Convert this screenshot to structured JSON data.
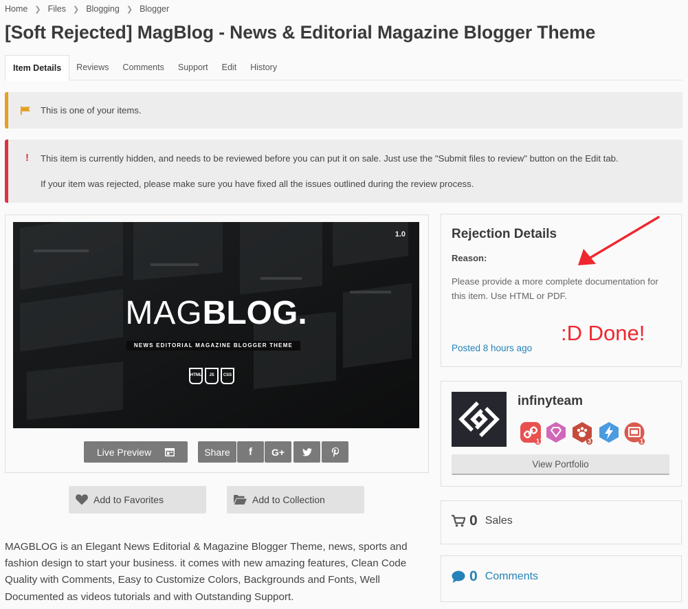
{
  "breadcrumb": [
    "Home",
    "Files",
    "Blogging",
    "Blogger"
  ],
  "title": "[Soft Rejected] MagBlog - News & Editorial Magazine Blogger Theme",
  "tabs": [
    "Item Details",
    "Reviews",
    "Comments",
    "Support",
    "Edit",
    "History"
  ],
  "notices": {
    "info": "This is one of your items.",
    "warning_line1": "This item is currently hidden, and needs to be reviewed before you can put it on sale. Just use the \"Submit files to review\" button on the Edit tab.",
    "warning_line2": "If your item was rejected, please make sure you have fixed all the issues outlined during the review process."
  },
  "preview": {
    "logo_light": "MAG",
    "logo_bold": "BLOG",
    "logo_dot": ".",
    "tagline": "NEWS EDITORIAL MAGAZINE BLOGGER THEME",
    "version": "1.0",
    "tech": [
      "HTML",
      "JS",
      "CSS"
    ]
  },
  "actions": {
    "live_preview": "Live Preview",
    "share": "Share",
    "social_icons": [
      "facebook-icon",
      "google-plus-icon",
      "twitter-icon",
      "pinterest-icon"
    ],
    "social_glyphs": [
      "f",
      "G+",
      "t",
      "p"
    ],
    "add_favorites": "Add to Favorites",
    "add_collection": "Add to Collection"
  },
  "description": "MAGBLOG is an Elegant News Editorial & Magazine Blogger Theme, news, sports and fashion design to start your business. it comes with new amazing features, Clean Code Quality with Comments, Easy to Customize Colors, Backgrounds and Fonts, Well Documented as videos tutorials and with Outstanding Support.",
  "rejection": {
    "title": "Rejection Details",
    "reason_label": "Reason:",
    "reason": "Please provide a more complete documentation for this item. Use HTML or PDF.",
    "posted": "Posted 8 hours ago",
    "annotation": ":D Done!"
  },
  "author": {
    "name": "infinyteam",
    "view_portfolio": "View Portfolio",
    "badges": [
      {
        "icon": "referral-badge-icon",
        "color": "#e8514f",
        "count": "1"
      },
      {
        "icon": "elite-author-badge-icon",
        "color": "#d067b9",
        "count": ""
      },
      {
        "icon": "author-level-badge-icon",
        "color": "#c64b3c",
        "count": "3"
      },
      {
        "icon": "power-elite-badge-icon",
        "color": "#4a9be0",
        "count": ""
      },
      {
        "icon": "sold-count-badge-icon",
        "color": "#d95a4f",
        "count": "1"
      }
    ]
  },
  "stats": {
    "sales_count": "0",
    "sales_label": "Sales",
    "comments_count": "0",
    "comments_label": "Comments"
  },
  "colors": {
    "accent_link": "#2582b8",
    "warning": "#d9363e",
    "info": "#e5a024",
    "annotation": "#f0272f"
  }
}
